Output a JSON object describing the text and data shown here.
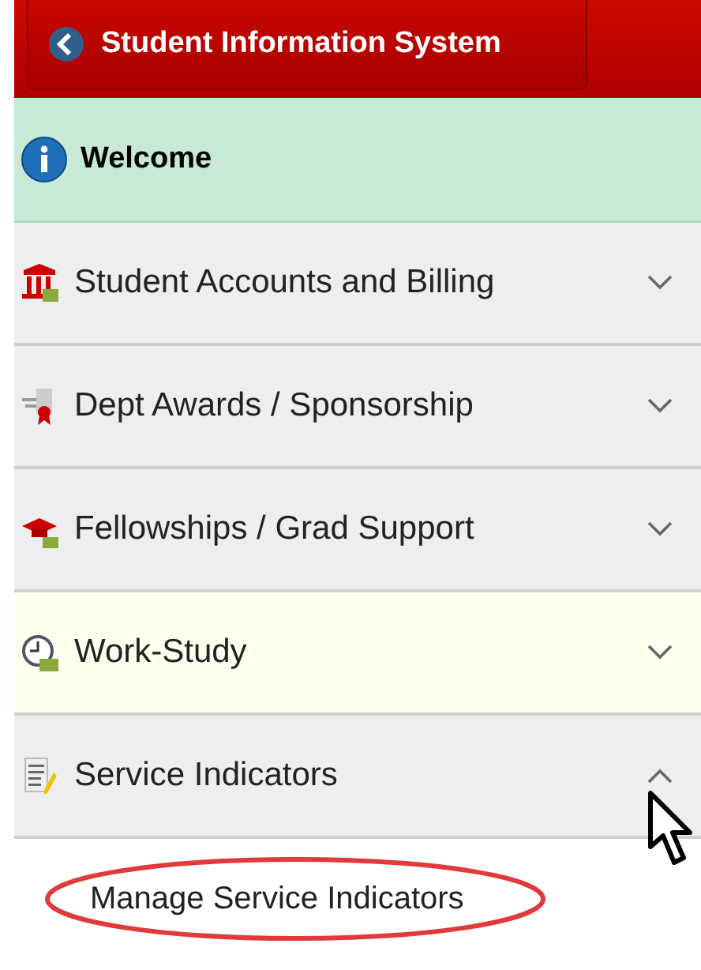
{
  "header": {
    "back_button": "Student Information System"
  },
  "welcome": {
    "label": "Welcome",
    "selected": true
  },
  "menu": [
    {
      "label": "Student Accounts and Billing",
      "expanded": false,
      "highlighted": false
    },
    {
      "label": "Dept Awards / Sponsorship",
      "expanded": false,
      "highlighted": false
    },
    {
      "label": "Fellowships / Grad Support",
      "expanded": false,
      "highlighted": false
    },
    {
      "label": "Work-Study",
      "expanded": false,
      "highlighted": true
    },
    {
      "label": "Service Indicators",
      "expanded": true,
      "highlighted": false,
      "children": [
        {
          "label": "Manage Service Indicators",
          "circled": true
        }
      ]
    }
  ]
}
